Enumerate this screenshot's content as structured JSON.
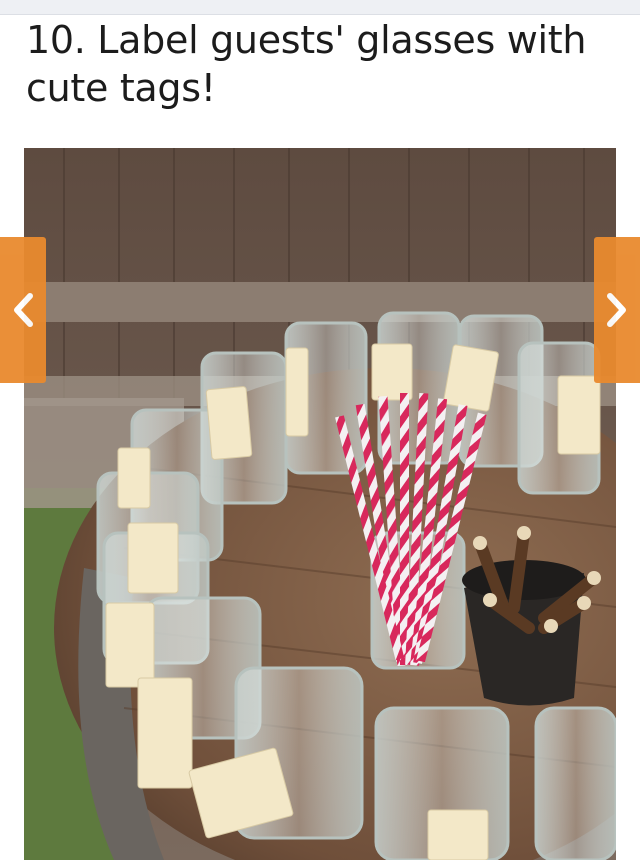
{
  "header": {
    "title": "10. Label guests' glasses with\ncute tags!"
  },
  "gallery": {
    "prev_icon": "chevron-left-icon",
    "next_icon": "chevron-right-icon",
    "accent_color": "#e98a2e"
  },
  "photo": {
    "subject": "mason jars with tags, striped straws and pencils on a wooden barrel"
  }
}
